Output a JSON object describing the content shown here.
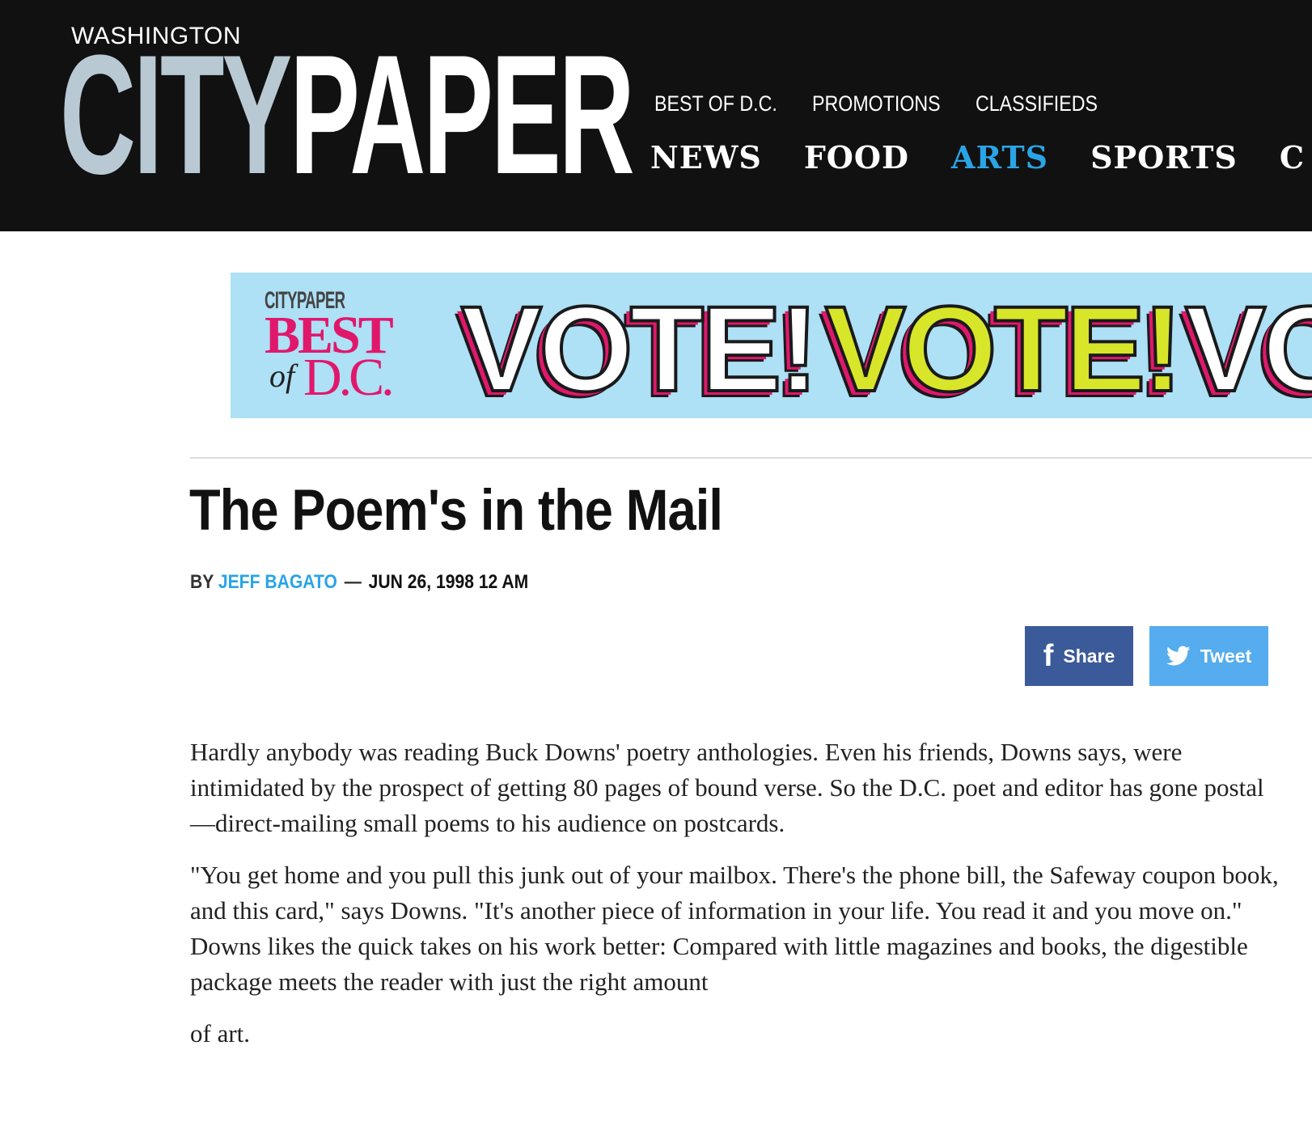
{
  "header": {
    "logo_small": "WASHINGTON",
    "logo_city": "CITY",
    "logo_paper": "PAPER",
    "nav_top": [
      "BEST OF D.C.",
      "PROMOTIONS",
      "CLASSIFIEDS"
    ],
    "nav_main": [
      "NEWS",
      "FOOD",
      "ARTS",
      "SPORTS",
      "C"
    ],
    "active_section": "ARTS",
    "accent_color": "#2aa4e6"
  },
  "ad": {
    "logo_small": "CITYPAPER",
    "best": "BEST",
    "of": "of",
    "dc": "D.C.",
    "vote": [
      "VOTE!",
      "VOTE!",
      "VO"
    ],
    "background_color": "#aee0f6"
  },
  "article": {
    "title": "The Poem's in the Mail",
    "byline_prefix": "BY",
    "author": "JEFF BAGATO",
    "dash": "—",
    "date": "JUN 26, 1998 12 AM",
    "share_label": "Share",
    "tweet_label": "Tweet",
    "share_color": "#3b5a99",
    "tweet_color": "#55acee",
    "paragraphs": [
      "Hardly anybody was reading Buck Downs' poetry anthologies. Even his friends, Downs says, were intimidated by the prospect of getting 80 pages of bound verse. So the D.C. poet and editor has gone postal—direct-mailing small poems to his audience on postcards.",
      "\"You get home and you pull this junk out of your mailbox. There's the phone bill, the Safeway coupon book, and this card,\" says Downs. \"It's another piece of information in your life. You read it and you move on.\" Downs likes the quick takes on his work better: Compared with little magazines and books, the digestible package meets the reader with just the right amount",
      "of art."
    ]
  },
  "icons": {
    "share": "facebook-icon",
    "tweet": "twitter-icon"
  }
}
